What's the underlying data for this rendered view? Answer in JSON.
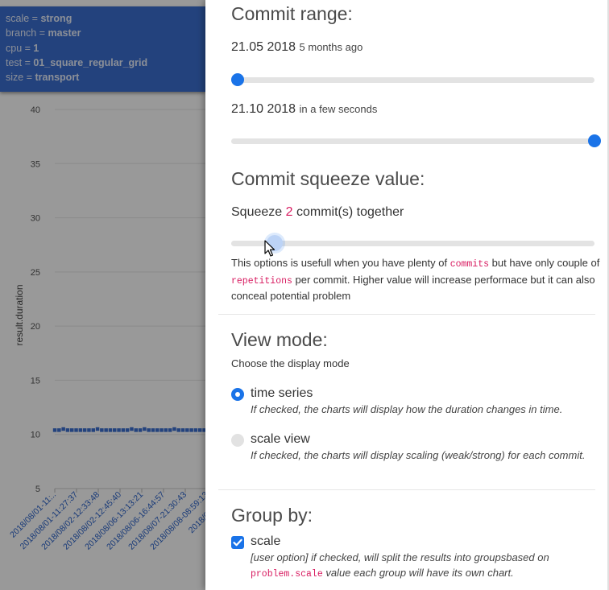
{
  "info_box": {
    "lines": [
      {
        "key": "scale",
        "value": "strong"
      },
      {
        "key": "branch",
        "value": "master"
      },
      {
        "key": "cpu",
        "value": "1"
      },
      {
        "key": "test",
        "value": "01_square_regular_grid"
      },
      {
        "key": "size",
        "value": "transport"
      }
    ],
    "separator": " = "
  },
  "chart_data": {
    "type": "scatter",
    "ylabel": "result.duration",
    "y_ticks": [
      5,
      10,
      15,
      20,
      25,
      30,
      35,
      40
    ],
    "ylim": [
      5,
      40
    ],
    "x_tick_labels": [
      "2018/08/01-11:..",
      "2018/08/01-11:27:37",
      "2018/08/02-12:33:48",
      "2018/08/02-12:45:40",
      "2018/08/06-13:13:21",
      "2018/08/06-16:44:57",
      "2018/08/07-21:30:43",
      "2018/08/08-08:59:13",
      "2018/08/08-1.."
    ],
    "series": [
      {
        "values": [
          10.4,
          10.4,
          10.5,
          10.4,
          10.4,
          10.4,
          10.4,
          10.4,
          10.4,
          10.4,
          10.5,
          10.4,
          10.4,
          10.4,
          10.4,
          10.4,
          10.4,
          10.4,
          10.5,
          10.4,
          10.4,
          10.5,
          10.4,
          10.4,
          10.4,
          10.4,
          10.4,
          10.4,
          10.5,
          10.4,
          10.4,
          10.4,
          10.4,
          10.4,
          10.4,
          10.4,
          10.4,
          10.5
        ],
        "color": "#3b6fd1"
      }
    ],
    "grid": true
  },
  "panel": {
    "commit_range": {
      "heading": "Commit range:",
      "start_date": "21.05 2018",
      "start_relative": "5 months ago",
      "end_date": "21.10 2018",
      "end_relative": "in a few seconds",
      "start_fraction": 0.0,
      "end_fraction": 1.0
    },
    "squeeze": {
      "heading": "Commit squeeze value:",
      "label_prefix": "Squeeze ",
      "value": "2",
      "label_suffix": " commit(s) together",
      "slider_fraction": 0.12,
      "help_1": "This options is usefull when you have plenty of ",
      "help_code_1": "commits",
      "help_2": " but have only couple of",
      "help_code_2": "repetitions",
      "help_3": " per commit. Higher value will increase performace but it can also",
      "help_4": "conceal potential problem"
    },
    "view_mode": {
      "heading": "View mode:",
      "subtitle": "Choose the display mode",
      "options": [
        {
          "label": "time series",
          "desc": "If checked, the charts will display how the duration changes in time.",
          "selected": true
        },
        {
          "label": "scale view",
          "desc": "If checked, the charts will display scaling (weak/strong) for each commit.",
          "selected": false
        }
      ]
    },
    "group_by": {
      "heading": "Group by:",
      "option_label": "scale",
      "checked": true,
      "desc_1": "[user option] if checked, will split the results into groupsbased on",
      "desc_code": "problem.scale",
      "desc_2": " value each group will have its own chart."
    }
  },
  "colors": {
    "accent": "#1a73e8",
    "info_box": "#3b6fd1",
    "code": "#d81b60"
  }
}
